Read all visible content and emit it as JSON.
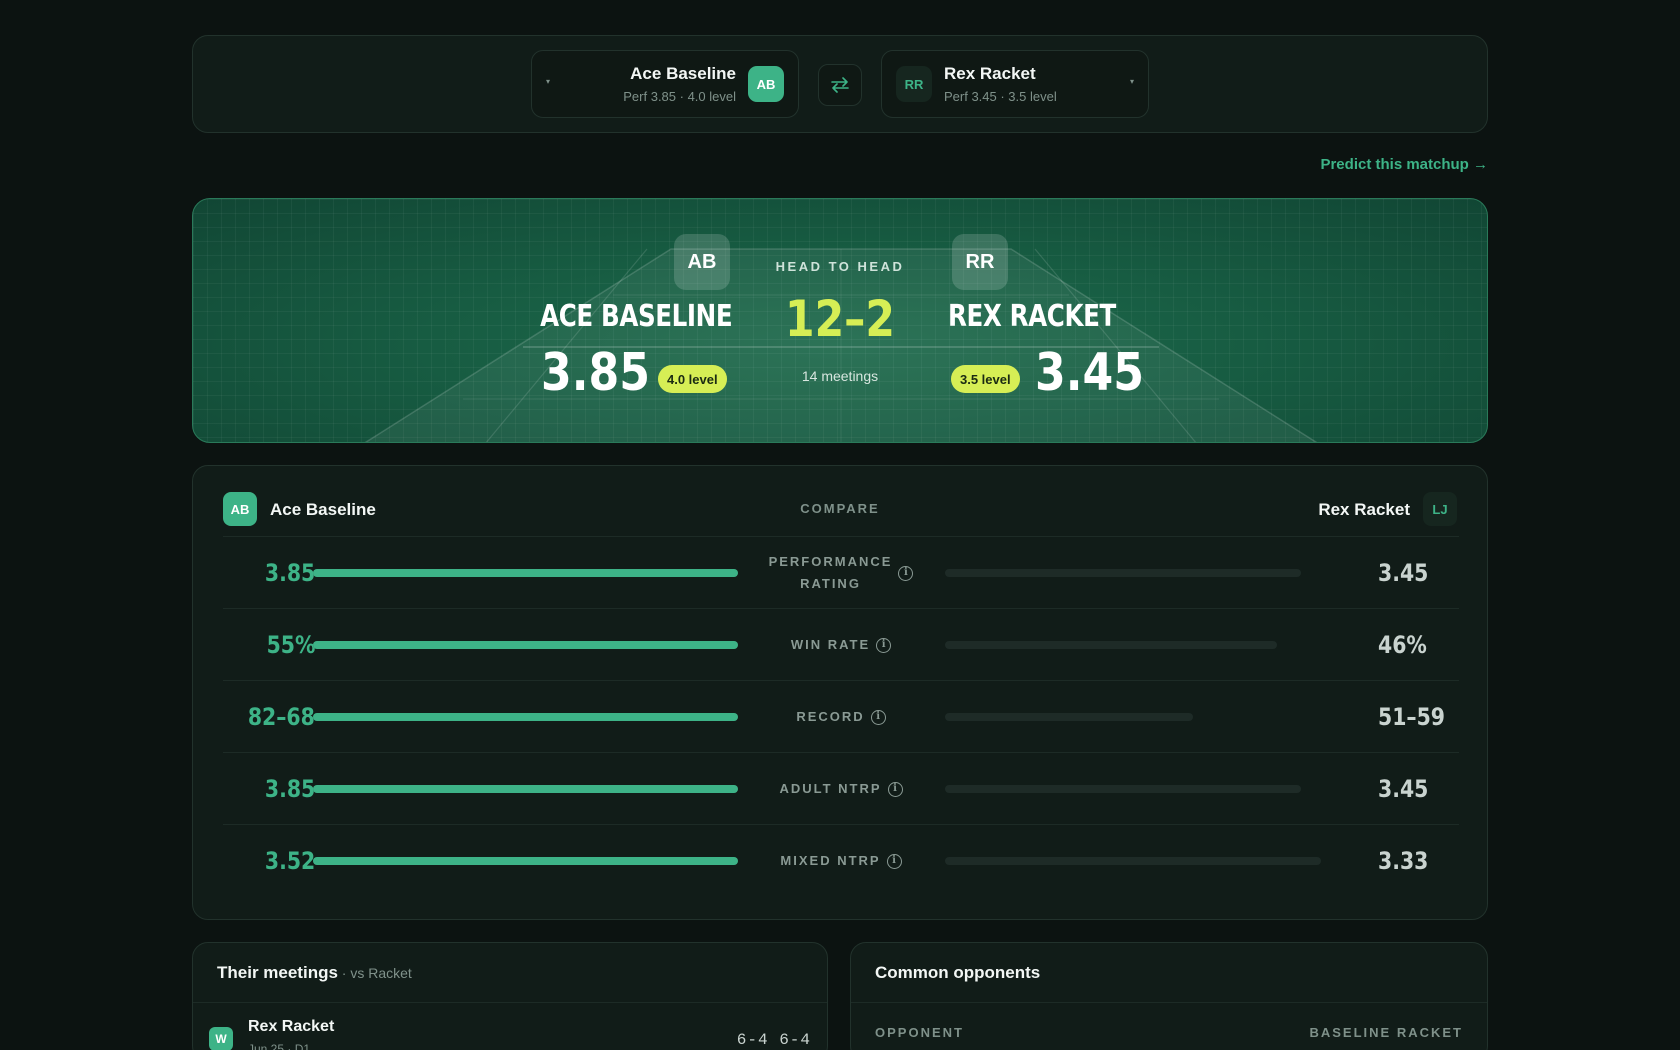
{
  "selector": {
    "left_player": {
      "name": "Ace Baseline",
      "sub": "Perf 3.85 · 4.0 level",
      "initials": "AB"
    },
    "right_player": {
      "name": "Rex Racket",
      "sub": "Perf 3.45 · 3.5 level",
      "initials": "RR"
    },
    "swap_icon": "swap-arrows-icon",
    "caret_glyph": "▾"
  },
  "predict_link": "Predict this matchup →",
  "hero": {
    "label": "HEAD TO HEAD",
    "score": "12–2",
    "meetings": "14 meetings",
    "left": {
      "initials": "AB",
      "name": "ACE BASELINE",
      "rating": "3.85",
      "level": "4.0 level"
    },
    "right": {
      "initials": "RR",
      "name": "REX RACKET",
      "rating": "3.45",
      "level": "3.5 level"
    }
  },
  "compare": {
    "title": "COMPARE",
    "left": {
      "initials": "AB",
      "name": "Ace Baseline"
    },
    "right": {
      "initials": "LJ",
      "name": "Rex Racket"
    },
    "rows": [
      {
        "metric_line1": "PERFORMANCE",
        "metric_line2": "RATING",
        "left": "3.85",
        "right": "3.45",
        "left_frac": 1.0,
        "right_frac": 0.89
      },
      {
        "metric_line1": "WIN RATE",
        "metric_line2": "",
        "left": "55%",
        "right": "46%",
        "left_frac": 1.0,
        "right_frac": 0.83
      },
      {
        "metric_line1": "RECORD",
        "metric_line2": "",
        "left": "82–68",
        "right": "51–59",
        "left_frac": 1.0,
        "right_frac": 0.62
      },
      {
        "metric_line1": "ADULT NTRP",
        "metric_line2": "",
        "left": "3.85",
        "right": "3.45",
        "left_frac": 1.0,
        "right_frac": 0.89
      },
      {
        "metric_line1": "MIXED NTRP",
        "metric_line2": "",
        "left": "3.52",
        "right": "3.33",
        "left_frac": 1.0,
        "right_frac": 0.94
      }
    ],
    "info_glyph": "i"
  },
  "meetings": {
    "title": "Their meetings",
    "subtitle": " · vs Racket",
    "items": [
      {
        "badge": "W",
        "opponent": "Rex Racket",
        "date": "Jun 25 · D1",
        "score": "6-4  6-4"
      }
    ]
  },
  "opponents": {
    "title": "Common opponents",
    "col_left": "OPPONENT",
    "col_right": "BASELINE RACKET"
  },
  "colors": {
    "accent": "#3db387",
    "highlight": "#d6ee55",
    "hero_bg": "#175c42",
    "page_bg": "#0c1311"
  }
}
